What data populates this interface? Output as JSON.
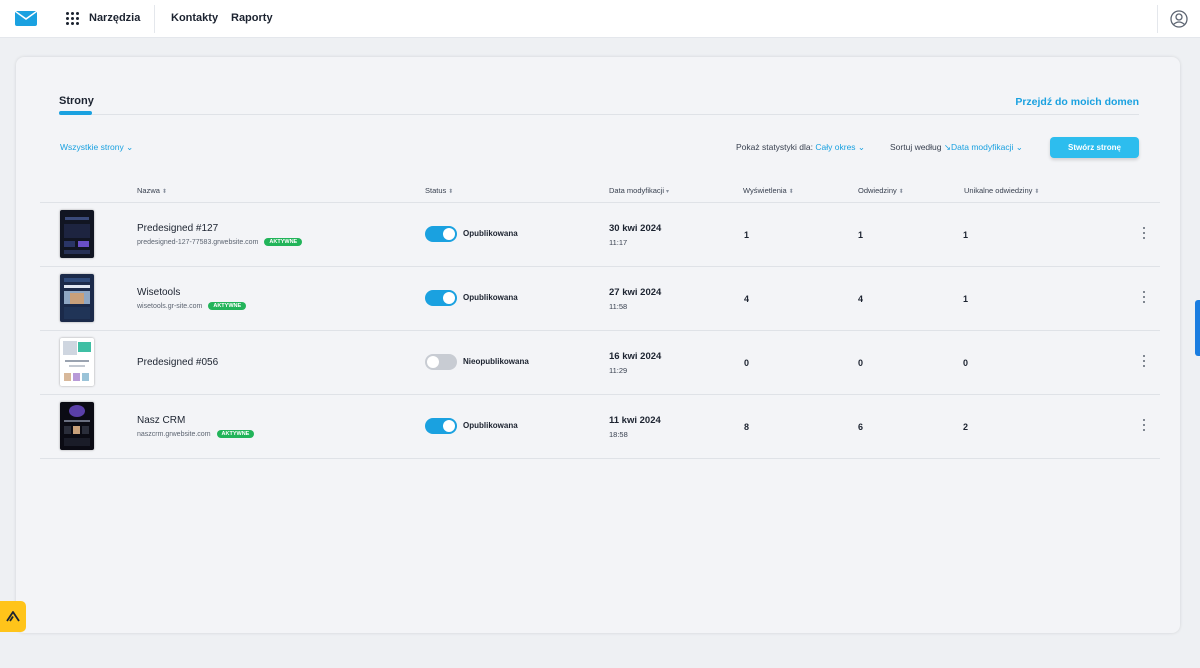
{
  "topbar": {
    "tools_label": "Narzędzia",
    "nav": [
      "Kontakty",
      "Raporty"
    ]
  },
  "tab": "Strony",
  "domains_link": "Przejdź do moich domen",
  "filter": "Wszystkie strony",
  "stats": {
    "label": "Pokaż statystyki dla:",
    "value": "Cały okres"
  },
  "sort": {
    "label": "Sortuj według",
    "value": "Data modyfikacji"
  },
  "create_button": "Stwórz stronę",
  "columns": {
    "name": "Nazwa",
    "status": "Status",
    "modified": "Data modyfikacji",
    "views": "Wyświetlenia",
    "visits": "Odwiedziny",
    "unique": "Unikalne odwiedziny"
  },
  "rows": [
    {
      "name": "Predesigned #127",
      "domain": "predesigned-127-77583.grwebsite.com",
      "badge": "AKTYWNE",
      "published": true,
      "status": "Opublikowana",
      "date": "30 kwi 2024",
      "time": "11:17",
      "views": "1",
      "visits": "1",
      "unique": "1"
    },
    {
      "name": "Wisetools",
      "domain": "wisetools.gr-site.com",
      "badge": "AKTYWNE",
      "published": true,
      "status": "Opublikowana",
      "date": "27 kwi 2024",
      "time": "11:58",
      "views": "4",
      "visits": "4",
      "unique": "1"
    },
    {
      "name": "Predesigned #056",
      "domain": "",
      "badge": "",
      "published": false,
      "status": "Nieopublikowana",
      "date": "16 kwi 2024",
      "time": "11:29",
      "views": "0",
      "visits": "0",
      "unique": "0"
    },
    {
      "name": "Nasz CRM",
      "domain": "naszcrm.grwebsite.com",
      "badge": "AKTYWNE",
      "published": true,
      "status": "Opublikowana",
      "date": "11 kwi 2024",
      "time": "18:58",
      "views": "8",
      "visits": "6",
      "unique": "2"
    }
  ],
  "colors": {
    "accent": "#1aa1e0",
    "badge": "#22b45a",
    "button": "#2dbdee"
  }
}
